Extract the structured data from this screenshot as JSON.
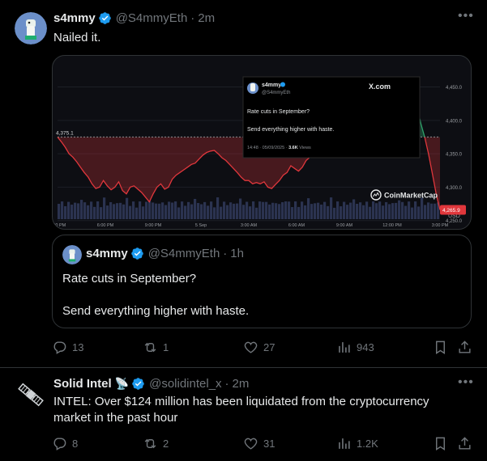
{
  "tweet1": {
    "author": {
      "name": "s4mmy",
      "handle": "@S4mmyEth",
      "time": "2m"
    },
    "text": "Nailed it.",
    "media": {
      "inner_card": {
        "name": "s4mmy",
        "handle": "@S4mmyEth",
        "brand": "X.com",
        "line1": "Rate cuts in September?",
        "line2": "Send everything higher with haste.",
        "meta": "14:48 · 05/09/2025 · ",
        "views_value": "3.6K",
        "views_label": " Views"
      },
      "coinmarketcap_label": "CoinMarketCap",
      "chart_data": {
        "type": "line",
        "title": "",
        "x_ticks": [
          "3:00 PM",
          "6:00 PM",
          "9:00 PM",
          "5 Sep",
          "3:00 AM",
          "6:00 AM",
          "9:00 AM",
          "12:00 PM",
          "3:00 PM"
        ],
        "y_ticks": [
          "4,450.0",
          "4,400.0",
          "4,350.0",
          "4,300.0",
          "4,250.0"
        ],
        "ylim": [
          4240,
          4470
        ],
        "y_unit": "USD",
        "start_label": "4,375.1",
        "end_label": "4,265.9",
        "reference_level": 4375.1,
        "grid": true,
        "series": [
          {
            "x": [
              0,
              1,
              2,
              3,
              4,
              5,
              6,
              7,
              8,
              9,
              10,
              11,
              12,
              13,
              14,
              15,
              16,
              17,
              18,
              19,
              20,
              21,
              22,
              23,
              24,
              25,
              26,
              27,
              28,
              29,
              30,
              31,
              32,
              33,
              34,
              35,
              36,
              37,
              38,
              39,
              40,
              41,
              42,
              43,
              44,
              45,
              46,
              47,
              48,
              49,
              50,
              51,
              52,
              53,
              54,
              55,
              56,
              57,
              58,
              59,
              60,
              61,
              62,
              63,
              64,
              65,
              66,
              67,
              68,
              69,
              70,
              71,
              72,
              73,
              74,
              75,
              76,
              77,
              78,
              79,
              80,
              81,
              82,
              83,
              84,
              85,
              86,
              87,
              88,
              89,
              90,
              91,
              92,
              93,
              94,
              95,
              96,
              97,
              98,
              99,
              100
            ],
            "values": [
              4375,
              4368,
              4360,
              4350,
              4345,
              4338,
              4330,
              4322,
              4315,
              4305,
              4298,
              4300,
              4310,
              4302,
              4296,
              4300,
              4308,
              4295,
              4290,
              4300,
              4302,
              4297,
              4292,
              4285,
              4278,
              4290,
              4300,
              4305,
              4297,
              4300,
              4312,
              4318,
              4322,
              4326,
              4330,
              4334,
              4336,
              4342,
              4348,
              4352,
              4354,
              4355,
              4350,
              4344,
              4340,
              4334,
              4328,
              4322,
              4315,
              4310,
              4310,
              4305,
              4307,
              4305,
              4308,
              4300,
              4298,
              4304,
              4310,
              4318,
              4322,
              4332,
              4328,
              4324,
              4330,
              4340,
              4345,
              4358,
              4365,
              4372,
              4378,
              4385,
              4398,
              4410,
              4420,
              4428,
              4436,
              4442,
              4448,
              4452,
              4456,
              4450,
              4446,
              4440,
              4444,
              4448,
              4452,
              4455,
              4451,
              4448,
              4450,
              4452,
              4450,
              4445,
              4420,
              4395,
              4375,
              4350,
              4320,
              4290,
              4266
            ]
          }
        ]
      }
    },
    "quote": {
      "name": "s4mmy",
      "handle": "@S4mmyEth",
      "time": "1h",
      "line1": "Rate cuts in September?",
      "line2": "Send everything higher with haste."
    },
    "actions": {
      "replies": "13",
      "reposts": "1",
      "likes": "27",
      "views": "943"
    }
  },
  "tweet2": {
    "author": {
      "name": "Solid Intel",
      "emoji": "📡",
      "handle": "@solidintel_x",
      "time": "2m"
    },
    "text": "INTEL: Over $124 million has been liquidated from the cryptocurrency market in the past hour",
    "actions": {
      "replies": "8",
      "reposts": "2",
      "likes": "31",
      "views": "1.2K"
    }
  },
  "separator_dot": "·",
  "colors": {
    "verified": "#1d9bf0",
    "muted": "#71767b",
    "border": "#2f3336",
    "up": "#2fa36b",
    "down": "#e0373c"
  }
}
